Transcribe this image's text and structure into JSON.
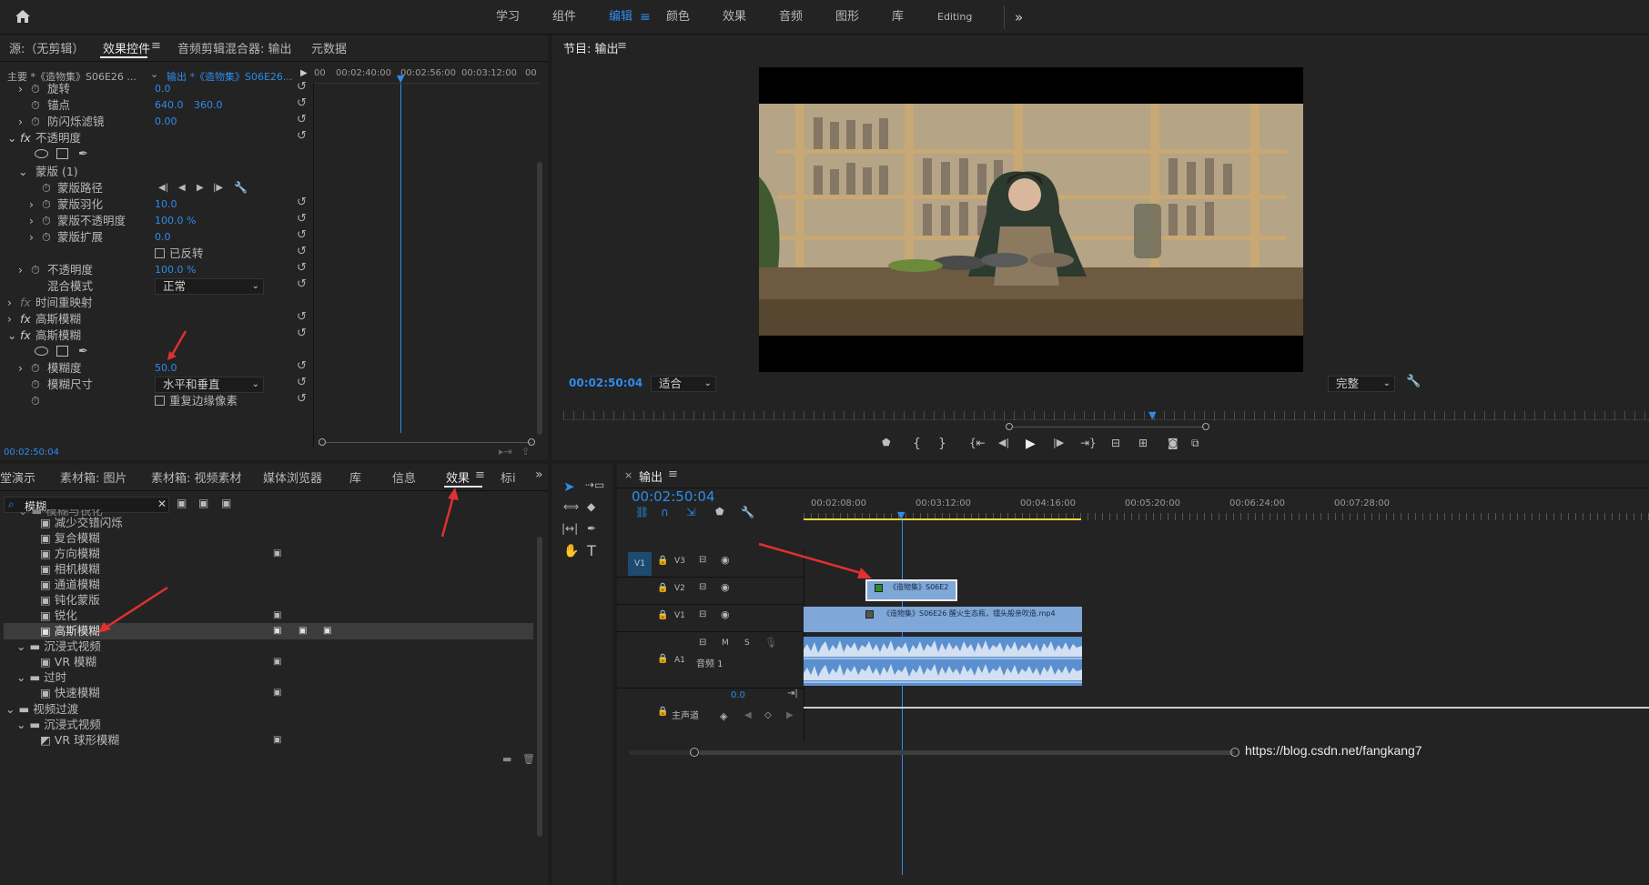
{
  "topbar": {
    "home_icon": "home-icon",
    "workspaces": [
      "学习",
      "组件",
      "编辑",
      "颜色",
      "效果",
      "音频",
      "图形",
      "库",
      "Editing"
    ],
    "active": "编辑",
    "more": "»"
  },
  "left_tabs": {
    "source": "源:（无剪辑）",
    "effect_controls": "效果控件",
    "audio_mixer": "音频剪辑混合器: 输出",
    "metadata": "元数据"
  },
  "ec": {
    "master": "主要 *《造物集》S06E26 ...",
    "output": "输出 *《造物集》S06E26...",
    "ruler": [
      "00",
      "00:02:40:00",
      "00:02:56:00",
      "00:03:12:00",
      "00"
    ],
    "rows": [
      {
        "label": "旋转",
        "v1": "0.0"
      },
      {
        "label": "锚点",
        "v1": "640.0",
        "v2": "360.0"
      },
      {
        "label": "防闪烁滤镜",
        "v1": "0.00"
      },
      {
        "label": "不透明度"
      },
      {
        "label": "蒙版 (1)"
      },
      {
        "label": "蒙版路径"
      },
      {
        "label": "蒙版羽化",
        "v1": "10.0"
      },
      {
        "label": "蒙版不透明度",
        "v1": "100.0 %"
      },
      {
        "label": "蒙版扩展",
        "v1": "0.0"
      },
      {
        "label": "已反转"
      },
      {
        "label": "不透明度",
        "v1": "100.0 %"
      },
      {
        "label": "混合模式",
        "v1": "正常"
      },
      {
        "label": "时间重映射"
      },
      {
        "label": "高斯模糊"
      },
      {
        "label": "高斯模糊"
      },
      {
        "label": "模糊度",
        "v1": "50.0"
      },
      {
        "label": "模糊尺寸",
        "v1": "水平和垂直"
      },
      {
        "label": "重复边缘像素"
      }
    ],
    "timecode": "00:02:50:04"
  },
  "program": {
    "title": "节目: 输出",
    "timecode": "00:02:50:04",
    "fit": "适合",
    "quality": "完整"
  },
  "lower_tabs": [
    "堂演示",
    "素材箱: 图片",
    "素材箱: 视频素材",
    "媒体浏览器",
    "库",
    "信息",
    "效果",
    "标i"
  ],
  "effects": {
    "search": "模糊",
    "items": [
      {
        "label": "模糊与锐化"
      },
      {
        "label": "减少交错闪烁"
      },
      {
        "label": "复合模糊"
      },
      {
        "label": "方向模糊"
      },
      {
        "label": "相机模糊"
      },
      {
        "label": "通道模糊"
      },
      {
        "label": "钝化蒙版"
      },
      {
        "label": "锐化"
      },
      {
        "label": "高斯模糊"
      },
      {
        "label": "沉浸式视频"
      },
      {
        "label": "VR 模糊"
      },
      {
        "label": "过时"
      },
      {
        "label": "快速模糊"
      },
      {
        "label": "视频过渡"
      },
      {
        "label": "沉浸式视频"
      },
      {
        "label": "VR 球形模糊"
      }
    ]
  },
  "timeline": {
    "title": "输出",
    "timecode": "00:02:50:04",
    "ruler": [
      "00:02:08:00",
      "00:03:12:00",
      "00:04:16:00",
      "00:05:20:00",
      "00:06:24:00",
      "00:07:28:00"
    ],
    "tracks": {
      "v3": "V3",
      "v2": "V2",
      "v1": "V1",
      "src_v1": "V1",
      "a1": "A1",
      "m": "M",
      "s": "S",
      "audio_name": "音频 1",
      "master": "主声道",
      "master_val": "0.0"
    },
    "clip_v2": "《造物集》S06E2",
    "clip_v1": "《造物集》S06E26 醒火生态瓶，镭头般亲吹造.mp4"
  },
  "watermark": "https://blog.csdn.net/fangkang7",
  "colors": {
    "accent": "#2d8ceb",
    "clip": "#7fa7d8",
    "audio": "#5a8fd0"
  }
}
